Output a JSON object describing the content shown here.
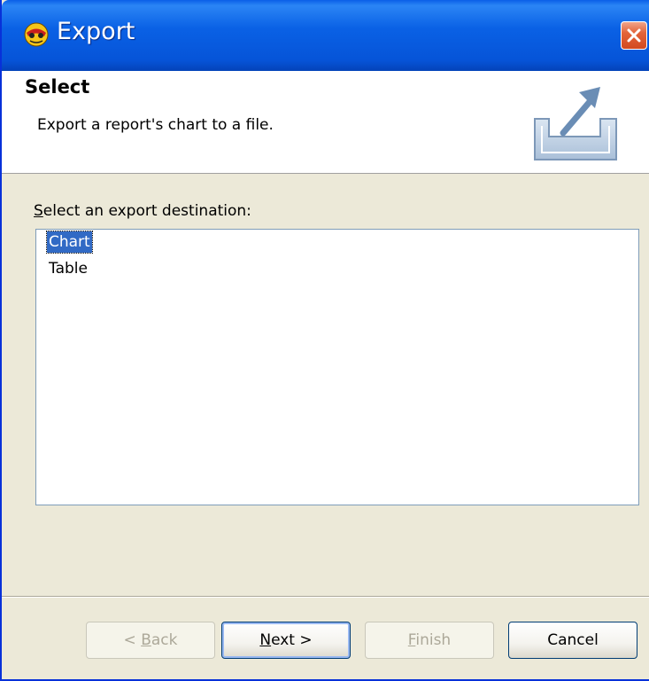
{
  "window": {
    "title": "Export"
  },
  "banner": {
    "title": "Select",
    "description": "Export a report's chart to a file."
  },
  "destination": {
    "label_mnemonic": "S",
    "label_rest": "elect an export destination:",
    "items": [
      {
        "label": "Chart",
        "selected": true
      },
      {
        "label": "Table",
        "selected": false
      }
    ]
  },
  "buttons": {
    "back": {
      "prefix": "< ",
      "mnemonic": "B",
      "rest": "ack",
      "enabled": false
    },
    "next": {
      "mnemonic": "N",
      "rest": "ext >",
      "enabled": true
    },
    "finish": {
      "mnemonic": "F",
      "rest": "inish",
      "enabled": false
    },
    "cancel": {
      "label": "Cancel",
      "enabled": true
    }
  },
  "colors": {
    "titlebar": "#0654d8",
    "selection": "#316ac5",
    "dialog_bg": "#ece9d8"
  }
}
